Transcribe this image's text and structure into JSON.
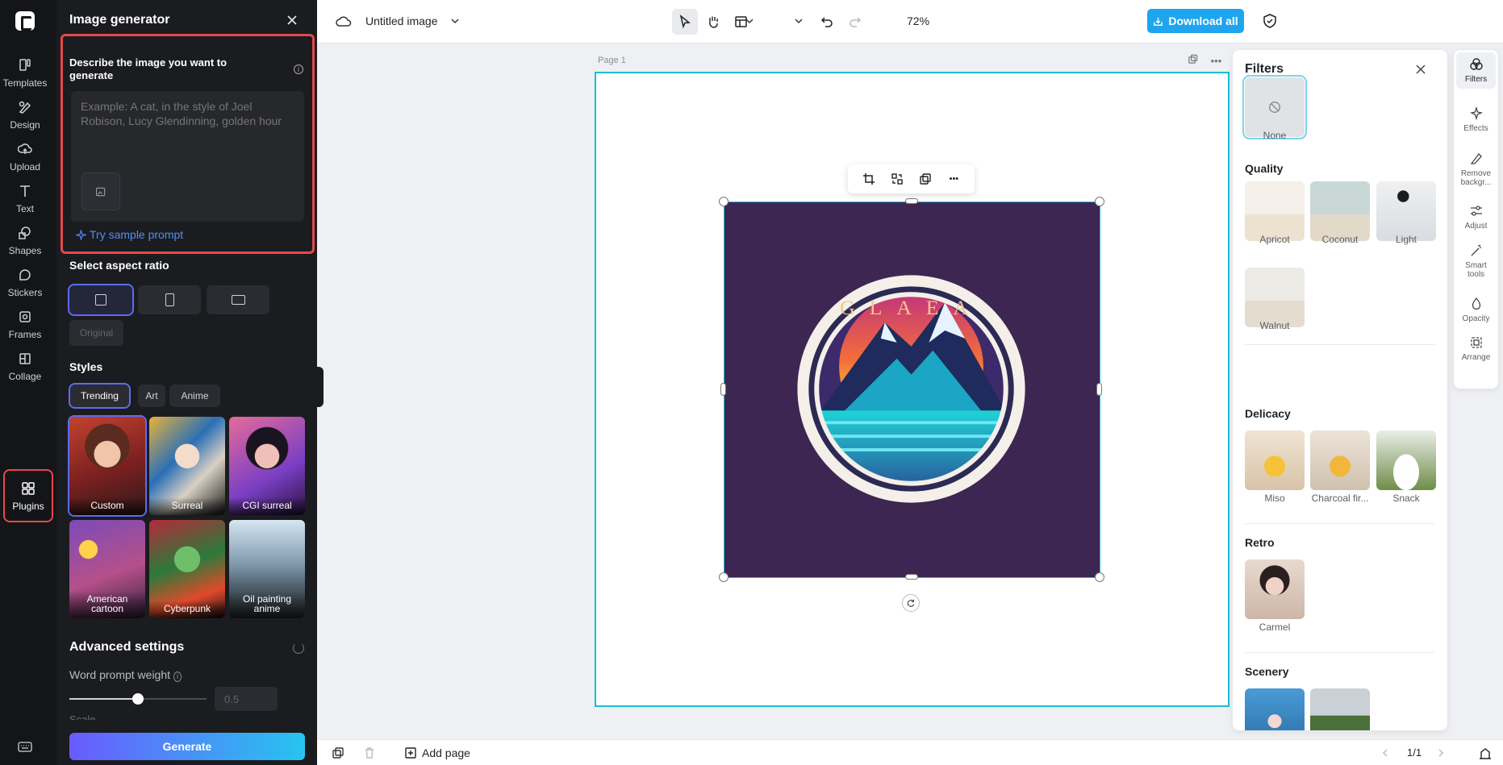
{
  "rail": {
    "items": [
      {
        "label": "Templates",
        "icon": "templates-icon"
      },
      {
        "label": "Design",
        "icon": "design-icon"
      },
      {
        "label": "Upload",
        "icon": "upload-icon"
      },
      {
        "label": "Text",
        "icon": "text-icon"
      },
      {
        "label": "Shapes",
        "icon": "shapes-icon"
      },
      {
        "label": "Stickers",
        "icon": "stickers-icon"
      },
      {
        "label": "Frames",
        "icon": "frames-icon"
      },
      {
        "label": "Collage",
        "icon": "collage-icon"
      },
      {
        "label": "Plugins",
        "icon": "plugins-icon"
      }
    ],
    "active": "Plugins"
  },
  "generator": {
    "title": "Image generator",
    "describe_label": "Describe the image you want to generate",
    "prompt_placeholder": "Example: A cat, in the style of Joel Robison, Lucy Glendinning, golden hour",
    "sample_prompt": "Try sample prompt",
    "aspect_label": "Select aspect ratio",
    "original_label": "Original",
    "styles_label": "Styles",
    "style_tabs": [
      "Trending",
      "Art",
      "Anime"
    ],
    "active_tab": "Trending",
    "styles": [
      {
        "label": "Custom"
      },
      {
        "label": "Surreal"
      },
      {
        "label": "CGI surreal"
      },
      {
        "label": "American cartoon"
      },
      {
        "label": "Cyberpunk"
      },
      {
        "label": "Oil painting anime"
      }
    ],
    "advanced_title": "Advanced settings",
    "weight_label": "Word prompt weight",
    "weight_value": "0.5",
    "weight_fraction": 0.5,
    "scale_label": "Scale",
    "generate_label": "Generate"
  },
  "topbar": {
    "title": "Untitled image",
    "zoom": "72%",
    "download_label": "Download all"
  },
  "canvas": {
    "page_label": "Page 1",
    "logo_text": "GLAEA"
  },
  "bottombar": {
    "add_page": "Add page",
    "pager": "1/1"
  },
  "filters": {
    "title": "Filters",
    "none_label": "None",
    "groups": [
      {
        "title": "Quality",
        "items": [
          "Apricot",
          "Coconut",
          "Light",
          "Walnut"
        ]
      },
      {
        "title": "Delicacy",
        "items": [
          "Miso",
          "Charcoal fir...",
          "Snack"
        ]
      },
      {
        "title": "Retro",
        "items": [
          "Carmel"
        ]
      },
      {
        "title": "Scenery",
        "items": []
      }
    ]
  },
  "right_rail": [
    {
      "label": "Filters"
    },
    {
      "label": "Effects"
    },
    {
      "label": "Remove backgr..."
    },
    {
      "label": "Adjust"
    },
    {
      "label": "Smart tools"
    },
    {
      "label": "Opacity"
    },
    {
      "label": "Arrange"
    }
  ],
  "colors": {
    "accent": "#1fa5ef",
    "highlight": "#e5484d",
    "selection": "#1dbbd8",
    "generate_start": "#6a5bff",
    "generate_end": "#27c4ef"
  }
}
